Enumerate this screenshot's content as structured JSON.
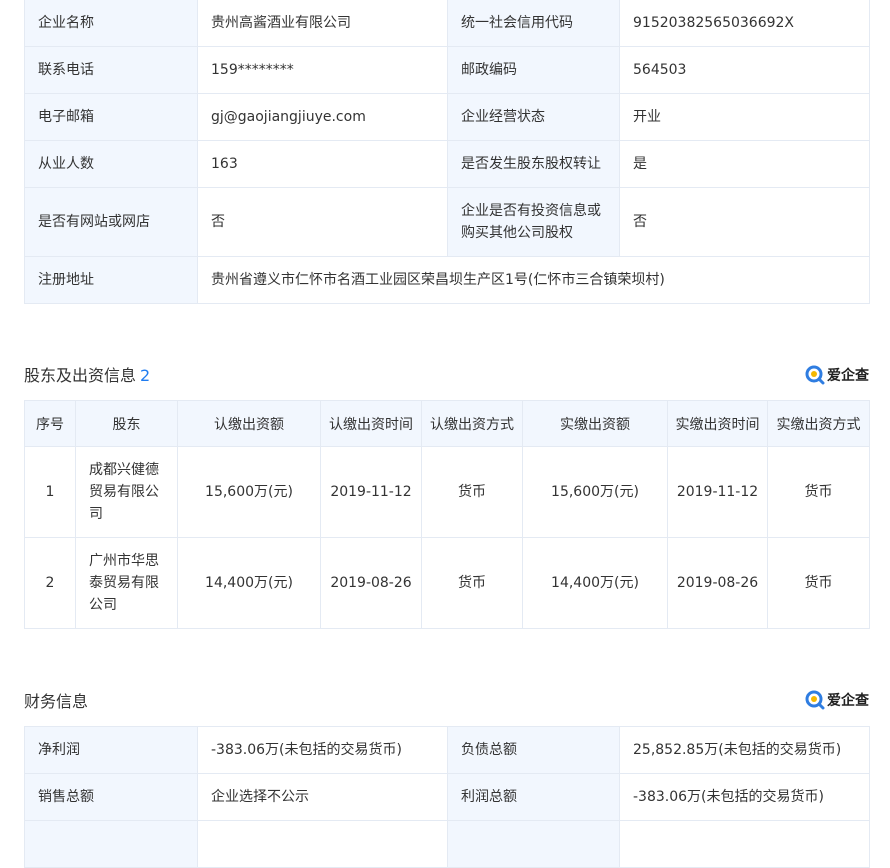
{
  "basic_info": {
    "rows": [
      [
        "企业名称",
        "贵州高酱酒业有限公司",
        "统一社会信用代码",
        "91520382565036692X"
      ],
      [
        "联系电话",
        "159********",
        "邮政编码",
        "564503"
      ],
      [
        "电子邮箱",
        "gj@gaojiangjiuye.com",
        "企业经营状态",
        "开业"
      ],
      [
        "从业人数",
        "163",
        "是否发生股东股权转让",
        "是"
      ],
      [
        "是否有网站或网店",
        "否",
        "企业是否有投资信息或购买其他公司股权",
        "否"
      ]
    ],
    "address_label": "注册地址",
    "address_value": "贵州省遵义市仁怀市名酒工业园区荣昌坝生产区1号(仁怀市三合镇荣坝村)"
  },
  "shareholders": {
    "title": "股东及出资信息",
    "count": "2",
    "logo_text": "爱企查",
    "headers": [
      "序号",
      "股东",
      "认缴出资额",
      "认缴出资时间",
      "认缴出资方式",
      "实缴出资额",
      "实缴出资时间",
      "实缴出资方式"
    ],
    "rows": [
      [
        "1",
        "成都兴健德贸易有限公司",
        "15,600万(元)",
        "2019-11-12",
        "货币",
        "15,600万(元)",
        "2019-11-12",
        "货币"
      ],
      [
        "2",
        "广州市华思泰贸易有限公司",
        "14,400万(元)",
        "2019-08-26",
        "货币",
        "14,400万(元)",
        "2019-08-26",
        "货币"
      ]
    ]
  },
  "finance": {
    "title": "财务信息",
    "logo_text": "爱企查",
    "rows": [
      [
        "净利润",
        "-383.06万(未包括的交易货币)",
        "负债总额",
        "25,852.85万(未包括的交易货币)"
      ],
      [
        "销售总额",
        "企业选择不公示",
        "利润总额",
        "-383.06万(未包括的交易货币)"
      ],
      [
        "",
        "",
        "",
        ""
      ]
    ]
  },
  "colors": {
    "label_bg": "#f2f7fe",
    "border": "#e4eaf3",
    "accent": "#1f7cf0"
  }
}
